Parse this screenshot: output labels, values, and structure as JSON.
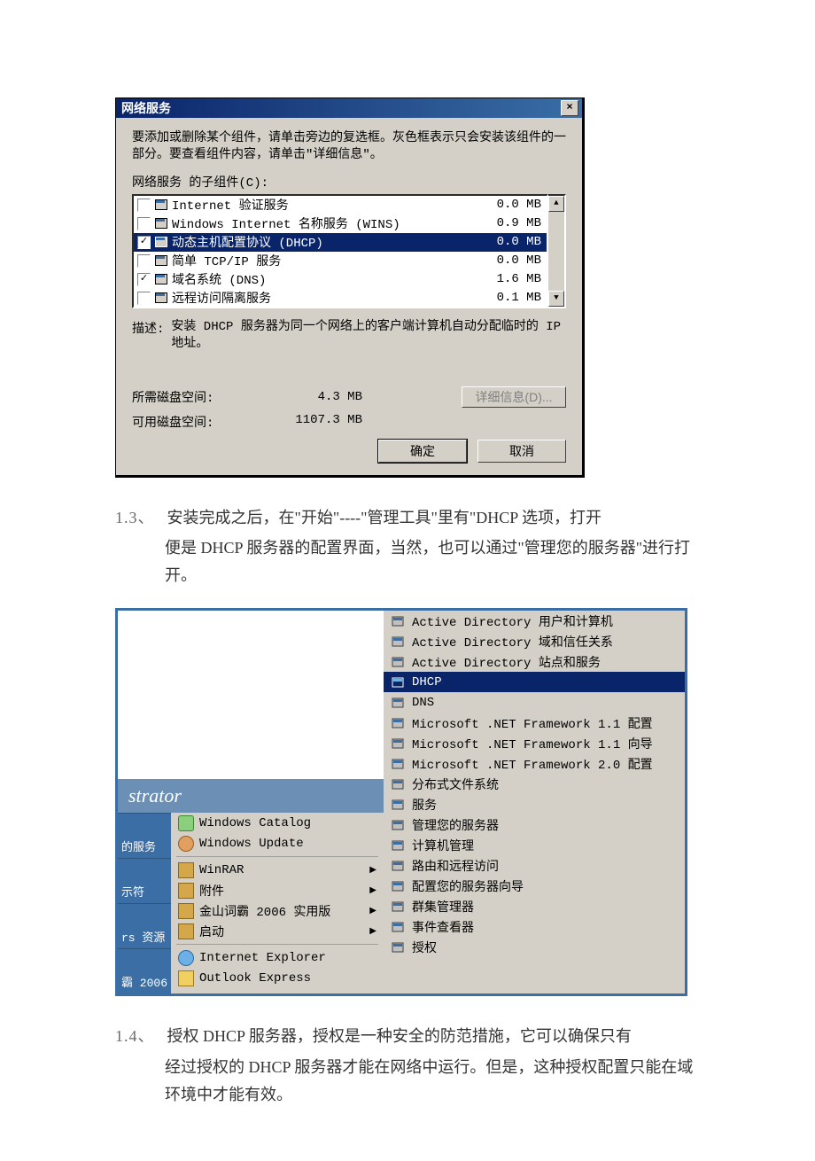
{
  "dialog": {
    "title": "网络服务",
    "close_symbol": "×",
    "instruction": "要添加或删除某个组件，请单击旁边的复选框。灰色框表示只会安装该组件的一部分。要查看组件内容，请单击\"详细信息\"。",
    "subcomponents_label": "网络服务 的子组件(C):",
    "items": [
      {
        "checked": false,
        "label": "Internet 验证服务",
        "size": "0.0 MB",
        "selected": false
      },
      {
        "checked": false,
        "label": "Windows Internet 名称服务 (WINS)",
        "size": "0.9 MB",
        "selected": false
      },
      {
        "checked": true,
        "label": "动态主机配置协议 (DHCP)",
        "size": "0.0 MB",
        "selected": true
      },
      {
        "checked": false,
        "label": "简单 TCP/IP 服务",
        "size": "0.0 MB",
        "selected": false
      },
      {
        "checked": true,
        "label": "域名系统 (DNS)",
        "size": "1.6 MB",
        "selected": false
      },
      {
        "checked": false,
        "label": "远程访问隔离服务",
        "size": "0.1 MB",
        "selected": false
      }
    ],
    "scroll_up": "▲",
    "scroll_down": "▼",
    "desc_label": "描述:",
    "desc_text": "安装 DHCP 服务器为同一个网络上的客户端计算机自动分配临时的 IP 地址。",
    "space_req_label": "所需磁盘空间:",
    "space_req_val": "4.3 MB",
    "space_avail_label": "可用磁盘空间:",
    "space_avail_val": "1107.3 MB",
    "details_btn": "详细信息(D)...",
    "ok_btn": "确定",
    "cancel_btn": "取消"
  },
  "para13_no": "1.3、",
  "para13": "安装完成之后，在\"开始\"----\"管理工具\"里有\"DHCP 选项，打开便是 DHCP 服务器的配置界面，当然，也可以通过\"管理您的服务器\"进行打开。",
  "menu": {
    "strator": "strator",
    "desk_left": [
      "的服务",
      "示符",
      "rs 资源",
      "霸 2006"
    ],
    "left": [
      {
        "label": "Windows Catalog",
        "icon": "cat"
      },
      {
        "label": "Windows Update",
        "icon": "upd"
      }
    ],
    "left_folders": [
      {
        "label": "WinRAR"
      },
      {
        "label": "附件"
      },
      {
        "label": "金山词霸 2006 实用版"
      },
      {
        "label": "启动"
      }
    ],
    "left_apps": [
      {
        "label": "Internet Explorer",
        "icon": "ie"
      },
      {
        "label": "Outlook Express",
        "icon": "oe"
      }
    ],
    "right": [
      {
        "label": "Active Directory 用户和计算机",
        "selected": false
      },
      {
        "label": "Active Directory 域和信任关系",
        "selected": false
      },
      {
        "label": "Active Directory 站点和服务",
        "selected": false
      },
      {
        "label": "DHCP",
        "selected": true
      },
      {
        "label": "DNS",
        "selected": false
      },
      {
        "label": "Microsoft .NET Framework 1.1 配置",
        "selected": false
      },
      {
        "label": "Microsoft .NET Framework 1.1 向导",
        "selected": false
      },
      {
        "label": "Microsoft .NET Framework 2.0 配置",
        "selected": false
      },
      {
        "label": "分布式文件系统",
        "selected": false
      },
      {
        "label": "服务",
        "selected": false
      },
      {
        "label": "管理您的服务器",
        "selected": false
      },
      {
        "label": "计算机管理",
        "selected": false
      },
      {
        "label": "路由和远程访问",
        "selected": false
      },
      {
        "label": "配置您的服务器向导",
        "selected": false
      },
      {
        "label": "群集管理器",
        "selected": false
      },
      {
        "label": "事件查看器",
        "selected": false
      },
      {
        "label": "授权",
        "selected": false
      }
    ]
  },
  "para14_no": "1.4、",
  "para14": "授权 DHCP 服务器，授权是一种安全的防范措施，它可以确保只有经过授权的 DHCP 服务器才能在网络中运行。但是，这种授权配置只能在域环境中才能有效。"
}
